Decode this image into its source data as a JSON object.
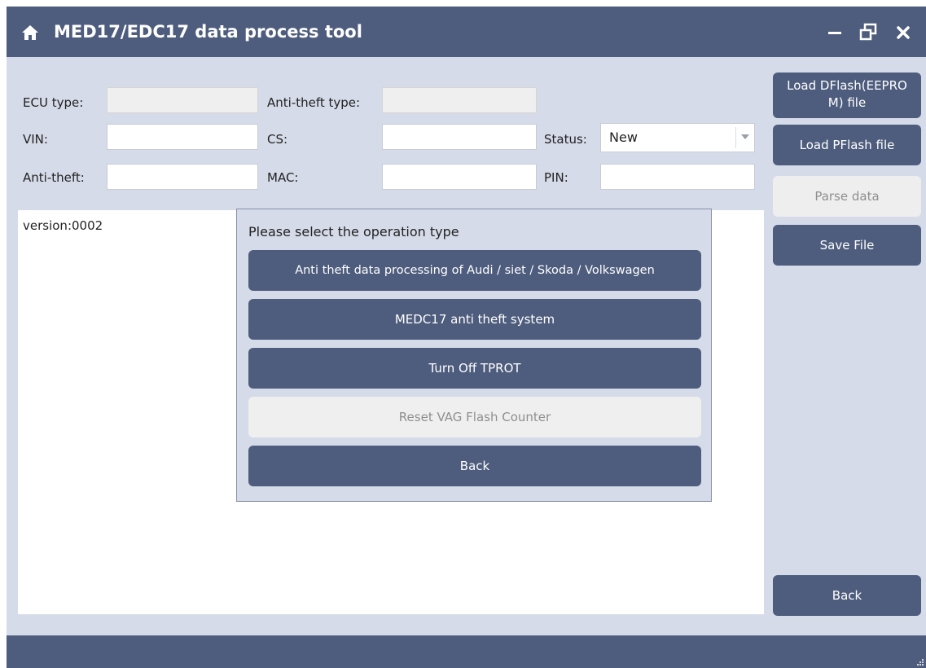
{
  "window": {
    "title": "MED17/EDC17 data process tool",
    "icons": {
      "home": "home-icon",
      "minimize": "minimize-icon",
      "restore": "restore-icon",
      "close": "close-icon"
    }
  },
  "form": {
    "ecu_type": {
      "label": "ECU type:",
      "value": ""
    },
    "anti_theft_type": {
      "label": "Anti-theft type:",
      "value": ""
    },
    "vin": {
      "label": "VIN:",
      "value": ""
    },
    "cs": {
      "label": "CS:",
      "value": ""
    },
    "status": {
      "label": "Status:",
      "selected": "New"
    },
    "anti_theft": {
      "label": "Anti-theft:",
      "value": ""
    },
    "mac": {
      "label": "MAC:",
      "value": ""
    },
    "pin": {
      "label": "PIN:",
      "value": ""
    }
  },
  "sidebar": {
    "load_dflash": "Load DFlash(EEPROM) file",
    "load_dflash_line1": "Load DFlash(EEPRO",
    "load_dflash_line2": "M) file",
    "load_pflash": "Load PFlash file",
    "parse_data": "Parse data",
    "save_file": "Save File",
    "back": "Back"
  },
  "log": {
    "text": "version:0002"
  },
  "dialog": {
    "title": "Please select the operation type",
    "options": [
      {
        "label": "Anti theft data processing of Audi / siet / Skoda / Volkswagen",
        "enabled": true
      },
      {
        "label": "MEDC17 anti theft system",
        "enabled": true
      },
      {
        "label": "Turn Off TPROT",
        "enabled": true
      },
      {
        "label": "Reset VAG Flash Counter",
        "enabled": false
      },
      {
        "label": "Back",
        "enabled": true
      }
    ]
  },
  "colors": {
    "titlebar": "#4e5d7d",
    "background": "#d5dbe8",
    "button": "#4e5d7d",
    "button_disabled": "#eeeeee"
  }
}
